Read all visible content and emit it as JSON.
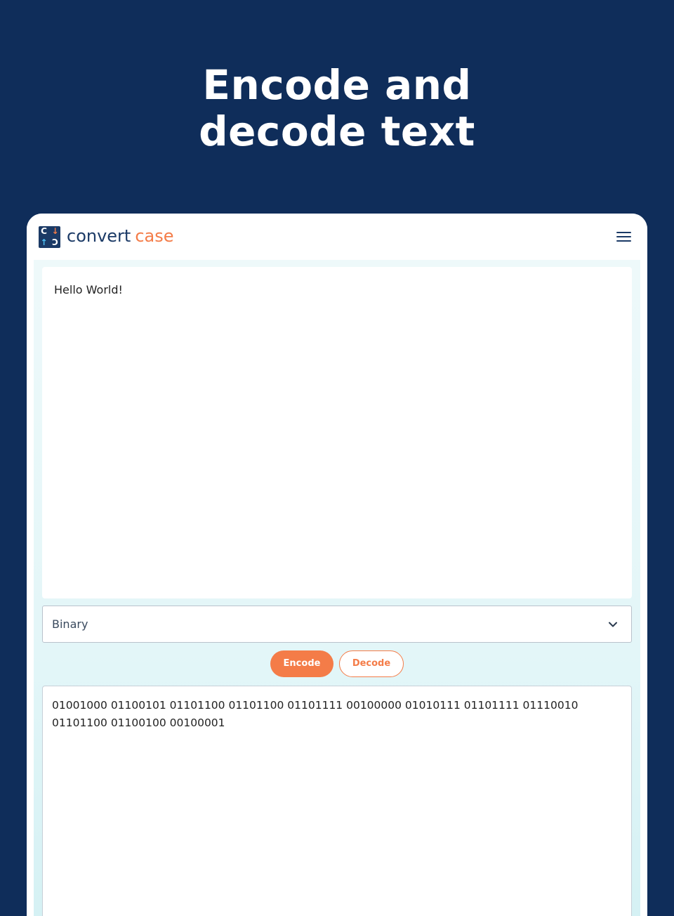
{
  "headline": {
    "line1": "Encode and",
    "line2": "decode text"
  },
  "app": {
    "brand_part1": "convert",
    "brand_part2": "case",
    "logo_icon": "convert-case-logo-icon",
    "menu_icon": "hamburger-menu-icon"
  },
  "input": {
    "value": "Hello World!"
  },
  "encoding_select": {
    "selected": "Binary",
    "icon": "chevron-down-icon"
  },
  "actions": {
    "encode_label": "Encode",
    "decode_label": "Decode"
  },
  "output": {
    "value": "01001000 01100101 01101100 01101100 01101111 00100000 01010111 01101111 01110010 01101100 01100100 00100001"
  },
  "colors": {
    "page_background": "#0f2d5a",
    "brand_navy": "#1b3a66",
    "accent_orange": "#f47c48",
    "content_tint": "#e3f6f8"
  }
}
